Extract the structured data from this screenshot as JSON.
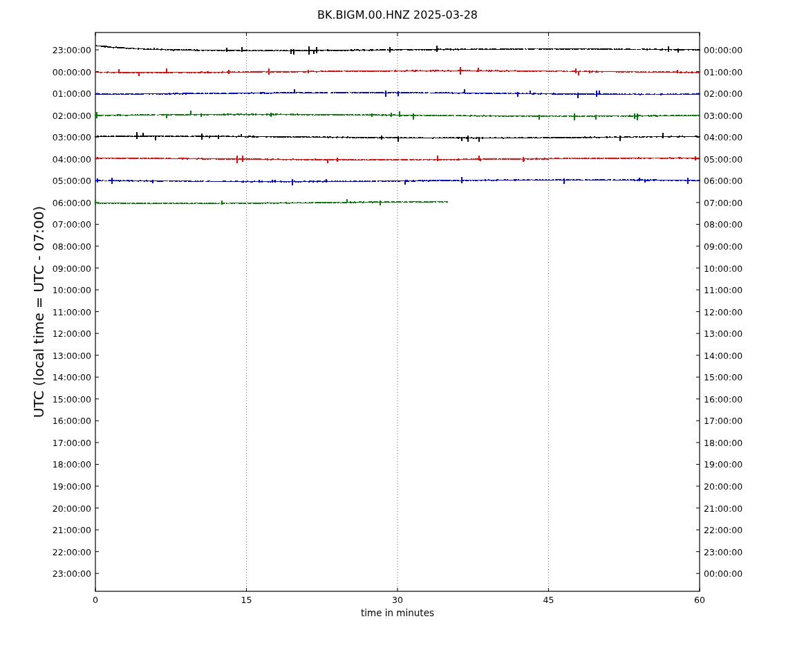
{
  "title": "BK.BIGM.00.HNZ 2025-03-28",
  "ylabel": "UTC (local time = UTC - 07:00)",
  "xlabel": "time in minutes",
  "xticks": [
    "0",
    "15",
    "30",
    "45",
    "60"
  ],
  "left_ticks": [
    "23:00:00",
    "00:00:00",
    "01:00:00",
    "02:00:00",
    "03:00:00",
    "04:00:00",
    "05:00:00",
    "06:00:00",
    "07:00:00",
    "08:00:00",
    "09:00:00",
    "10:00:00",
    "11:00:00",
    "12:00:00",
    "13:00:00",
    "14:00:00",
    "15:00:00",
    "16:00:00",
    "17:00:00",
    "18:00:00",
    "19:00:00",
    "20:00:00",
    "21:00:00",
    "22:00:00",
    "23:00:00"
  ],
  "right_ticks": [
    "00:00:00",
    "01:00:00",
    "02:00:00",
    "03:00:00",
    "04:00:00",
    "05:00:00",
    "06:00:00",
    "07:00:00",
    "08:00:00",
    "09:00:00",
    "10:00:00",
    "11:00:00",
    "12:00:00",
    "13:00:00",
    "14:00:00",
    "15:00:00",
    "16:00:00",
    "17:00:00",
    "18:00:00",
    "19:00:00",
    "20:00:00",
    "21:00:00",
    "22:00:00",
    "23:00:00",
    "00:00:00"
  ],
  "traces": [
    {
      "color": "#000000",
      "level": 1
    },
    {
      "color": "#ff0000",
      "level": 1
    },
    {
      "color": "#0000ff",
      "level": 1
    },
    {
      "color": "#008000",
      "level": 1
    },
    {
      "color": "#000000",
      "level": 1
    },
    {
      "color": "#ff0000",
      "level": 1
    },
    {
      "color": "#0000ff",
      "level": 1
    },
    {
      "color": "#008000",
      "level": 0.583
    }
  ]
}
